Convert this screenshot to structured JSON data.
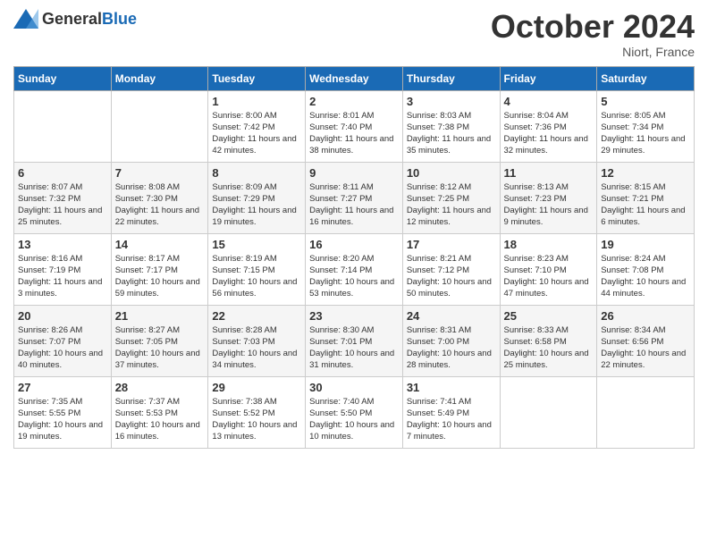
{
  "header": {
    "logo_general": "General",
    "logo_blue": "Blue",
    "month_title": "October 2024",
    "location": "Niort, France"
  },
  "days_of_week": [
    "Sunday",
    "Monday",
    "Tuesday",
    "Wednesday",
    "Thursday",
    "Friday",
    "Saturday"
  ],
  "weeks": [
    [
      {
        "day": "",
        "content": ""
      },
      {
        "day": "",
        "content": ""
      },
      {
        "day": "1",
        "content": "Sunrise: 8:00 AM\nSunset: 7:42 PM\nDaylight: 11 hours and 42 minutes."
      },
      {
        "day": "2",
        "content": "Sunrise: 8:01 AM\nSunset: 7:40 PM\nDaylight: 11 hours and 38 minutes."
      },
      {
        "day": "3",
        "content": "Sunrise: 8:03 AM\nSunset: 7:38 PM\nDaylight: 11 hours and 35 minutes."
      },
      {
        "day": "4",
        "content": "Sunrise: 8:04 AM\nSunset: 7:36 PM\nDaylight: 11 hours and 32 minutes."
      },
      {
        "day": "5",
        "content": "Sunrise: 8:05 AM\nSunset: 7:34 PM\nDaylight: 11 hours and 29 minutes."
      }
    ],
    [
      {
        "day": "6",
        "content": "Sunrise: 8:07 AM\nSunset: 7:32 PM\nDaylight: 11 hours and 25 minutes."
      },
      {
        "day": "7",
        "content": "Sunrise: 8:08 AM\nSunset: 7:30 PM\nDaylight: 11 hours and 22 minutes."
      },
      {
        "day": "8",
        "content": "Sunrise: 8:09 AM\nSunset: 7:29 PM\nDaylight: 11 hours and 19 minutes."
      },
      {
        "day": "9",
        "content": "Sunrise: 8:11 AM\nSunset: 7:27 PM\nDaylight: 11 hours and 16 minutes."
      },
      {
        "day": "10",
        "content": "Sunrise: 8:12 AM\nSunset: 7:25 PM\nDaylight: 11 hours and 12 minutes."
      },
      {
        "day": "11",
        "content": "Sunrise: 8:13 AM\nSunset: 7:23 PM\nDaylight: 11 hours and 9 minutes."
      },
      {
        "day": "12",
        "content": "Sunrise: 8:15 AM\nSunset: 7:21 PM\nDaylight: 11 hours and 6 minutes."
      }
    ],
    [
      {
        "day": "13",
        "content": "Sunrise: 8:16 AM\nSunset: 7:19 PM\nDaylight: 11 hours and 3 minutes."
      },
      {
        "day": "14",
        "content": "Sunrise: 8:17 AM\nSunset: 7:17 PM\nDaylight: 10 hours and 59 minutes."
      },
      {
        "day": "15",
        "content": "Sunrise: 8:19 AM\nSunset: 7:15 PM\nDaylight: 10 hours and 56 minutes."
      },
      {
        "day": "16",
        "content": "Sunrise: 8:20 AM\nSunset: 7:14 PM\nDaylight: 10 hours and 53 minutes."
      },
      {
        "day": "17",
        "content": "Sunrise: 8:21 AM\nSunset: 7:12 PM\nDaylight: 10 hours and 50 minutes."
      },
      {
        "day": "18",
        "content": "Sunrise: 8:23 AM\nSunset: 7:10 PM\nDaylight: 10 hours and 47 minutes."
      },
      {
        "day": "19",
        "content": "Sunrise: 8:24 AM\nSunset: 7:08 PM\nDaylight: 10 hours and 44 minutes."
      }
    ],
    [
      {
        "day": "20",
        "content": "Sunrise: 8:26 AM\nSunset: 7:07 PM\nDaylight: 10 hours and 40 minutes."
      },
      {
        "day": "21",
        "content": "Sunrise: 8:27 AM\nSunset: 7:05 PM\nDaylight: 10 hours and 37 minutes."
      },
      {
        "day": "22",
        "content": "Sunrise: 8:28 AM\nSunset: 7:03 PM\nDaylight: 10 hours and 34 minutes."
      },
      {
        "day": "23",
        "content": "Sunrise: 8:30 AM\nSunset: 7:01 PM\nDaylight: 10 hours and 31 minutes."
      },
      {
        "day": "24",
        "content": "Sunrise: 8:31 AM\nSunset: 7:00 PM\nDaylight: 10 hours and 28 minutes."
      },
      {
        "day": "25",
        "content": "Sunrise: 8:33 AM\nSunset: 6:58 PM\nDaylight: 10 hours and 25 minutes."
      },
      {
        "day": "26",
        "content": "Sunrise: 8:34 AM\nSunset: 6:56 PM\nDaylight: 10 hours and 22 minutes."
      }
    ],
    [
      {
        "day": "27",
        "content": "Sunrise: 7:35 AM\nSunset: 5:55 PM\nDaylight: 10 hours and 19 minutes."
      },
      {
        "day": "28",
        "content": "Sunrise: 7:37 AM\nSunset: 5:53 PM\nDaylight: 10 hours and 16 minutes."
      },
      {
        "day": "29",
        "content": "Sunrise: 7:38 AM\nSunset: 5:52 PM\nDaylight: 10 hours and 13 minutes."
      },
      {
        "day": "30",
        "content": "Sunrise: 7:40 AM\nSunset: 5:50 PM\nDaylight: 10 hours and 10 minutes."
      },
      {
        "day": "31",
        "content": "Sunrise: 7:41 AM\nSunset: 5:49 PM\nDaylight: 10 hours and 7 minutes."
      },
      {
        "day": "",
        "content": ""
      },
      {
        "day": "",
        "content": ""
      }
    ]
  ]
}
